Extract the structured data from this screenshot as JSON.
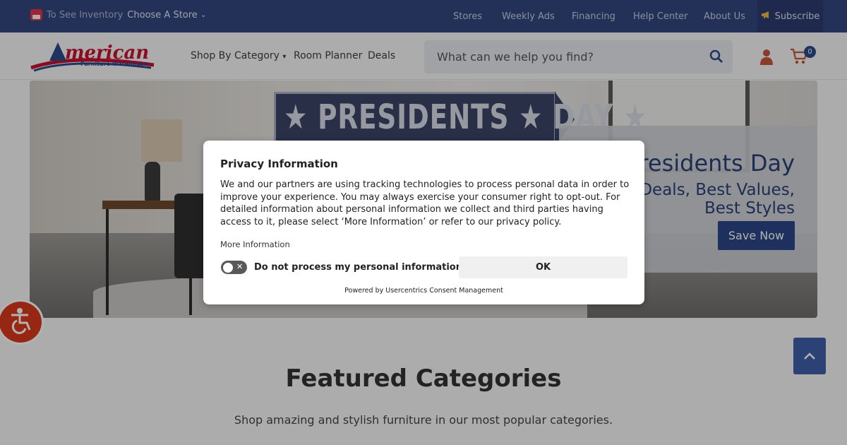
{
  "topbar": {
    "inventory_label": "To See Inventory",
    "choose_store": "Choose A Store",
    "links": [
      "Stores",
      "Weekly Ads",
      "Financing",
      "Help Center",
      "About Us"
    ],
    "subscribe": "Subscribe"
  },
  "header": {
    "logo_main": "American",
    "logo_sub": "Furniture Warehouse",
    "nav": [
      "Shop By Category",
      "Room Planner",
      "Deals"
    ],
    "search_placeholder": "What can we help you find?",
    "cart_count": "0"
  },
  "hero": {
    "banner": "PRESIDENTS DAY",
    "title": "Presidents Day",
    "subtitle_line1": "t Deals, Best Values,",
    "subtitle_line2": "Best Styles",
    "cta": "Save Now"
  },
  "featured": {
    "title": "Featured Categories",
    "subtitle": "Shop amazing and stylish furniture in our most popular categories."
  },
  "privacy": {
    "title": "Privacy Information",
    "body": "We and our partners are using tracking technologies to process personal data in order to improve your experience. You may always exercise your consumer right to opt-out. For detailed information about personal information we collect and third parties having access to it, please select ‘More Information’ or refer to our privacy policy.",
    "more_info": "More Information",
    "toggle_label": "Do not process my personal information",
    "ok": "OK",
    "powered": "Powered by Usercentrics Consent Management"
  },
  "colors": {
    "topbar": "#33467f",
    "accent_red": "#d8391c",
    "brand_blue": "#2c4686"
  }
}
